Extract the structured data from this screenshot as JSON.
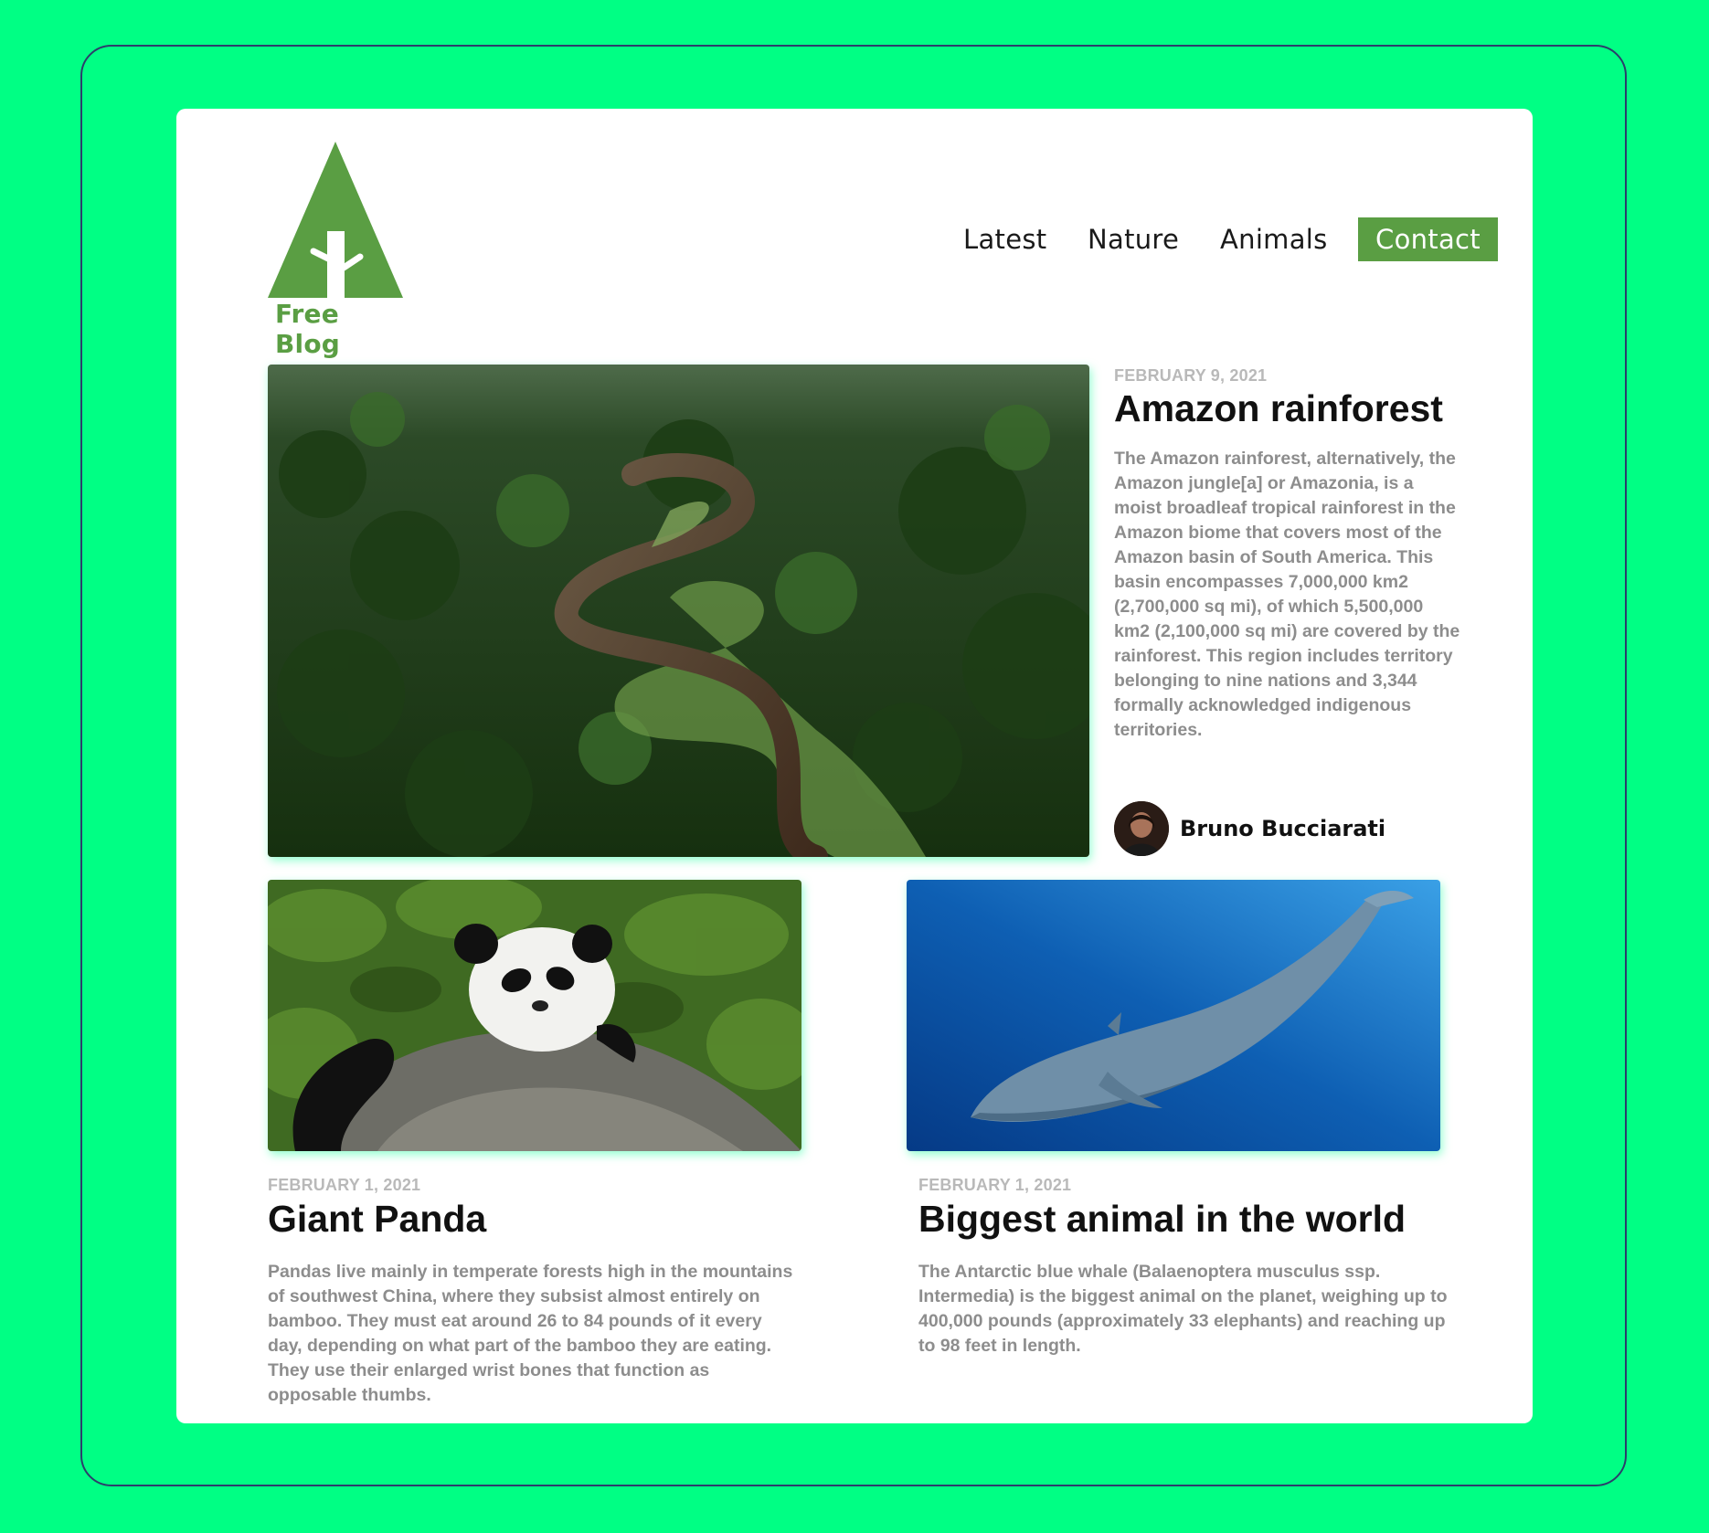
{
  "brand": {
    "name": "Free Blog",
    "color": "#5a9e43",
    "logo_icon": "tree-triangle-icon"
  },
  "nav": {
    "items": [
      {
        "label": "Latest"
      },
      {
        "label": "Nature"
      },
      {
        "label": "Animals"
      },
      {
        "label": "Contact"
      }
    ],
    "active": "Contact"
  },
  "featured": {
    "date": "FEBRUARY 9, 2021",
    "title": "Amazon rainforest",
    "description": "The Amazon rainforest, alternatively, the Amazon jungle[a] or Amazonia, is a moist broadleaf tropical rainforest in the Amazon biome that covers most of the Amazon basin of South America. This basin encompasses 7,000,000 km2 (2,700,000 sq mi), of which 5,500,000 km2 (2,100,000 sq mi) are covered by the rainforest. This region includes territory belonging to nine nations and 3,344 formally acknowledged indigenous territories.",
    "image": "aerial river rainforest photo",
    "author": "Bruno Bucciarati"
  },
  "posts": [
    {
      "date": "FEBRUARY 1, 2021",
      "title": "Giant Panda",
      "description": "Pandas live mainly in temperate forests high in the mountains of southwest China, where they subsist almost entirely on bamboo. They must eat around 26 to 84 pounds of it every day, depending on what part of the bamboo they are eating. They use their enlarged wrist bones that function as opposable thumbs.",
      "image": "panda resting on rock photo"
    },
    {
      "date": "FEBRUARY 1, 2021",
      "title": "Biggest animal in the world",
      "description": "The Antarctic blue whale (Balaenoptera musculus ssp. Intermedia) is the biggest animal on the planet, weighing up to 400,000 pounds (approximately 33 elephants) and reaching up to 98 feet in length.",
      "image": "blue whale underwater photo"
    }
  ],
  "colors": {
    "background": "#00ff84",
    "card": "#ffffff",
    "accent": "#5a9e43",
    "date": "#b9b9b9",
    "body_text": "#8d8d8d"
  }
}
